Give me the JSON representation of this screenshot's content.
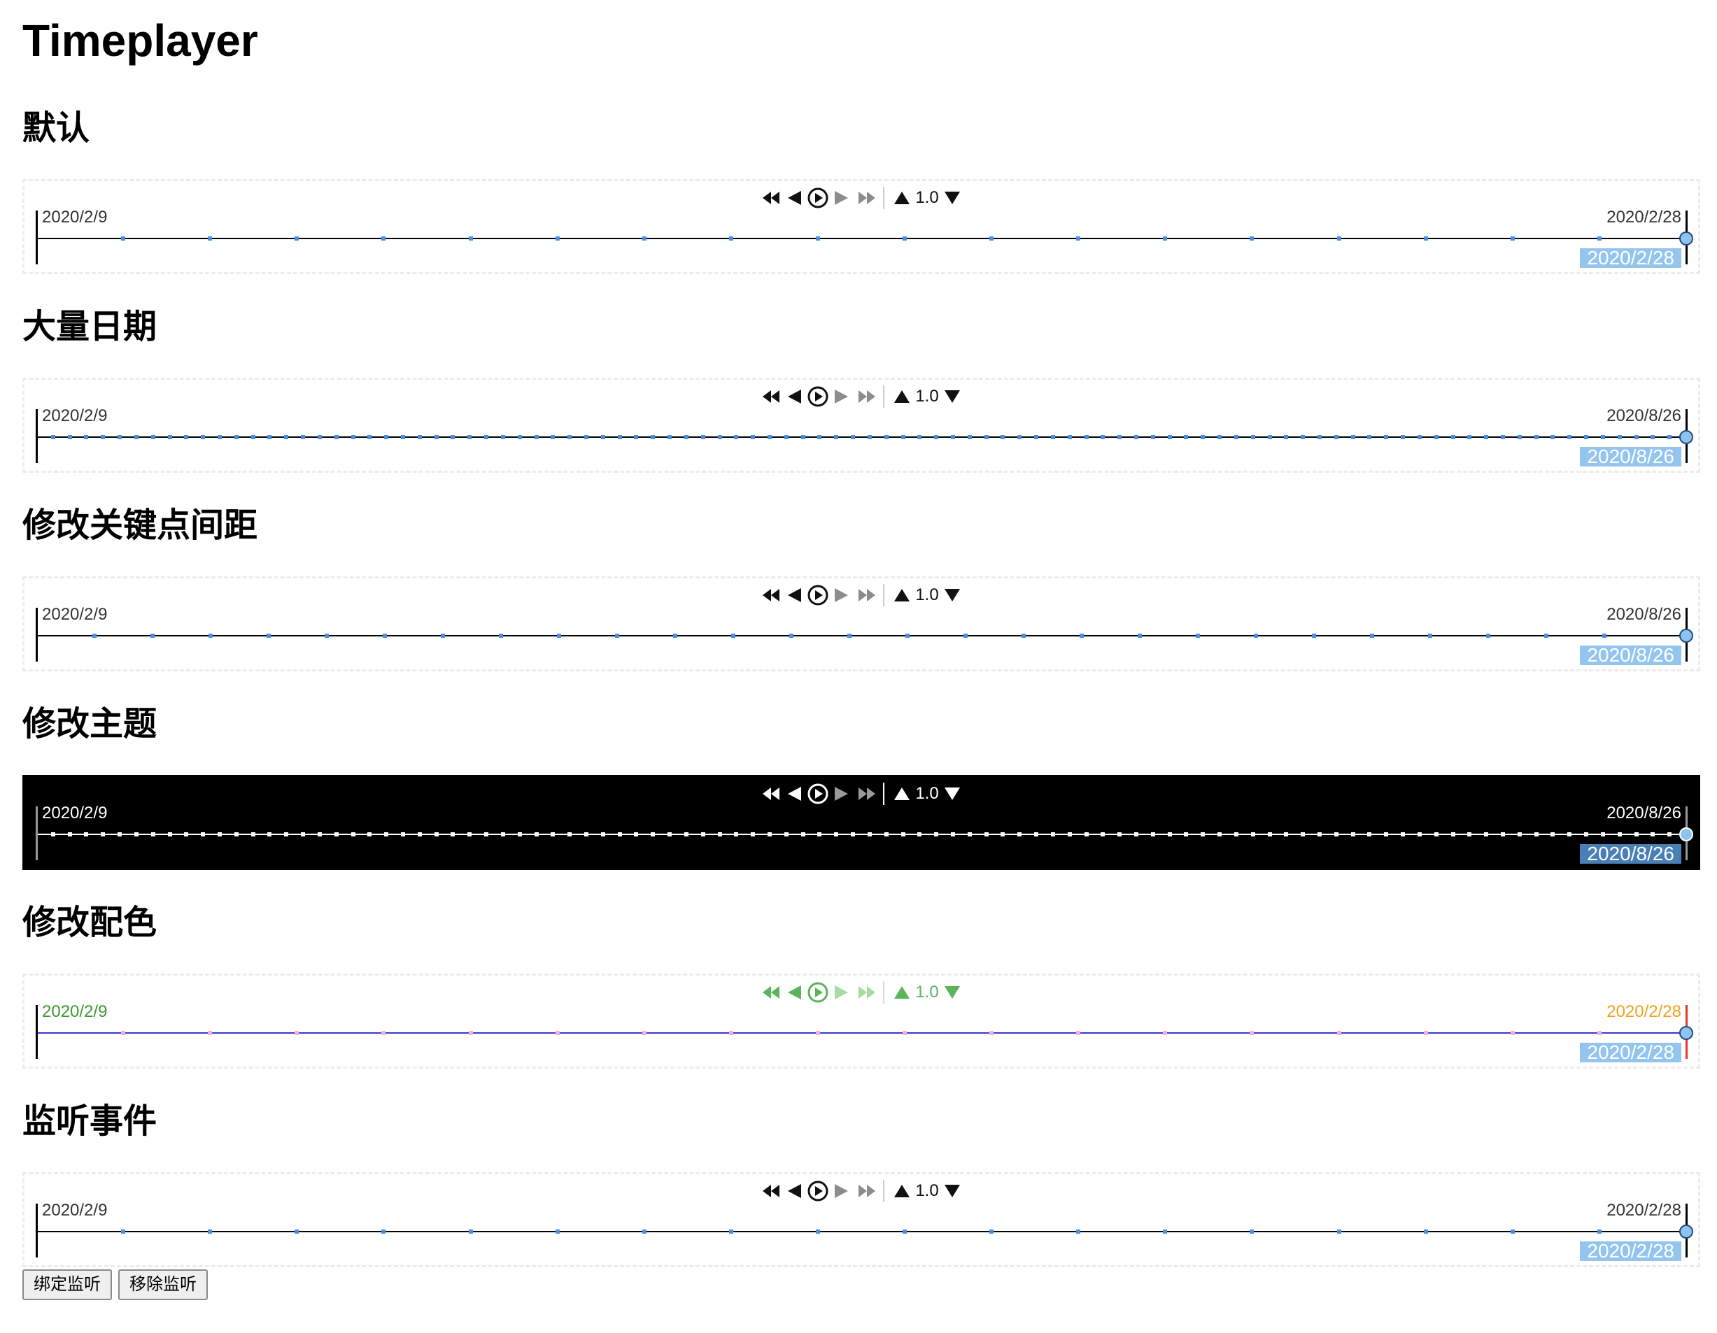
{
  "page": {
    "title": "Timeplayer"
  },
  "controls": {
    "icons": [
      "skip-to-start-icon",
      "step-back-icon",
      "play-icon",
      "step-forward-icon",
      "skip-to-end-icon",
      "speed-up-icon",
      "speed-down-icon"
    ],
    "disabled": [
      "step-forward-icon",
      "skip-to-end-icon"
    ]
  },
  "default_colors": {
    "background": "#ffffff",
    "border": "#ececec",
    "control": "#111111",
    "control_disabled": "#8c8c8c",
    "separator": "#cccccc",
    "speed_text": "#111111",
    "date_start": "#333333",
    "date_end": "#333333",
    "axis": "#000000",
    "tick": "#4a8fe7",
    "bar_start": "#000000",
    "bar_end": "#000000",
    "pointer": "#8ec3ef",
    "pointer_ring": "#1e4d7b",
    "current_bg": "#93c5ef",
    "current_text": "#ffffff"
  },
  "sections": [
    {
      "heading": "默认",
      "start": "2020/2/9",
      "end": "2020/2/28",
      "current": "2020/2/28",
      "speed": "1.0"
    },
    {
      "heading": "大量日期",
      "start": "2020/2/9",
      "end": "2020/8/26",
      "current": "2020/8/26",
      "speed": "1.0"
    },
    {
      "heading": "修改关键点间距",
      "start": "2020/2/9",
      "end": "2020/8/26",
      "current": "2020/8/26",
      "speed": "1.0"
    },
    {
      "heading": "修改主题",
      "start": "2020/2/9",
      "end": "2020/8/26",
      "current": "2020/8/26",
      "speed": "1.0",
      "colors": {
        "background": "#000000",
        "border": "#000000",
        "control": "#ffffff",
        "control_disabled": "#9a9a9a",
        "separator": "#ffffff",
        "speed_text": "#ffffff",
        "date_start": "#ffffff",
        "date_end": "#ffffff",
        "axis": "#ffffff",
        "tick": "#ffffff",
        "bar_start": "#9a9a9a",
        "bar_end": "#9a9a9a",
        "pointer": "#8ec3ef",
        "pointer_ring": "#ffffff",
        "current_bg": "#4a7fb5",
        "current_text": "#ffffff"
      }
    },
    {
      "heading": "修改配色",
      "start": "2020/2/9",
      "end": "2020/2/28",
      "current": "2020/2/28",
      "speed": "1.0",
      "colors": {
        "control": "#5ab55a",
        "control_disabled": "#a6dba2",
        "separator": "#d8d8d8",
        "speed_text": "#5ab55a",
        "date_start": "#3a9b2f",
        "date_end": "#f0a21e",
        "axis": "#3636d6",
        "tick": "#f4b3c8",
        "bar_start": "#000000",
        "bar_end": "#e8352b"
      }
    },
    {
      "heading": "监听事件",
      "start": "2020/2/9",
      "end": "2020/2/28",
      "current": "2020/2/28",
      "speed": "1.0"
    }
  ],
  "buttons": {
    "bind": "绑定监听",
    "unbind": "移除监听"
  }
}
